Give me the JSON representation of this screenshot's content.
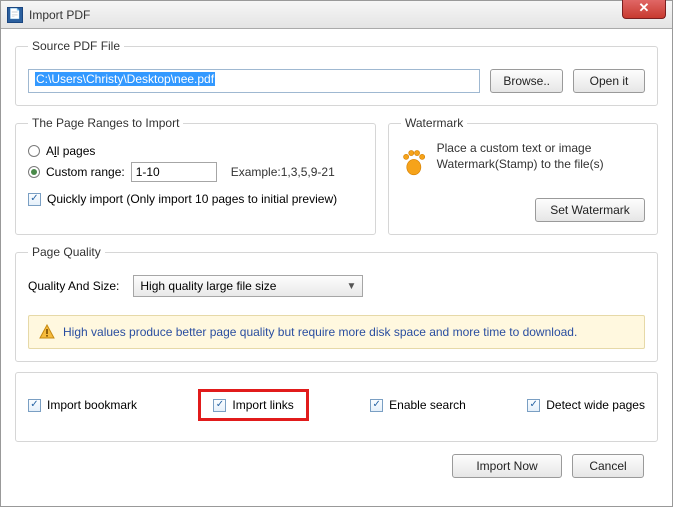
{
  "title": "Import PDF",
  "source": {
    "legend": "Source PDF File",
    "path": "C:\\Users\\Christy\\Desktop\\nee.pdf",
    "browse": "Browse..",
    "open": "Open it"
  },
  "ranges": {
    "legend": "The Page Ranges to Import",
    "all_label_pre": "A",
    "all_label_ul": "l",
    "all_label_post": "l pages",
    "custom_label": "Custom range:",
    "custom_value": "1-10",
    "example": "Example:1,3,5,9-21",
    "quick_label": "Quickly import (Only import 10 pages to  initial  preview)"
  },
  "watermark": {
    "legend": "Watermark",
    "desc": "Place a custom text or image Watermark(Stamp) to the file(s)",
    "set_btn": "Set Watermark"
  },
  "quality": {
    "legend": "Page Quality",
    "label": "Quality And Size:",
    "selected": "High quality large file size",
    "note": "High values produce better page quality but require more disk space and more time to download."
  },
  "options": {
    "bookmark": "Import bookmark",
    "links": "Import links",
    "search": "Enable search",
    "wide": "Detect wide pages"
  },
  "footer": {
    "import": "Import Now",
    "cancel": "Cancel"
  }
}
